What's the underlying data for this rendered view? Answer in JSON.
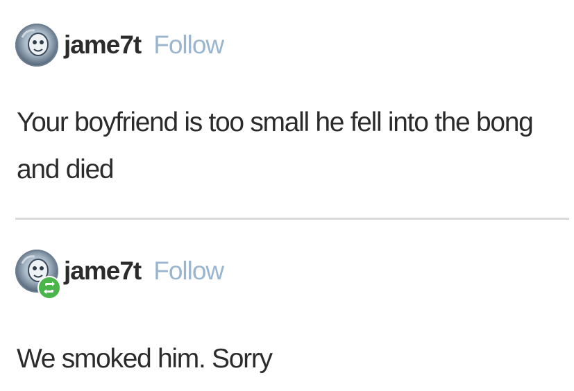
{
  "posts": [
    {
      "username": "jame7t",
      "follow_label": "Follow",
      "text": "Your boyfriend is too small he fell into the bong and died",
      "avatar_icon": "cartoon-face-avatar",
      "reblog_badge": false
    },
    {
      "username": "jame7t",
      "follow_label": "Follow",
      "text": "We smoked him. Sorry",
      "avatar_icon": "cartoon-face-avatar",
      "reblog_badge": true,
      "badge_icon": "reblog-icon",
      "badge_color": "#49b54a"
    }
  ],
  "colors": {
    "text": "#2b2b2b",
    "follow": "#9ab5cf",
    "divider": "#d9d9d9",
    "background": "#ffffff"
  }
}
